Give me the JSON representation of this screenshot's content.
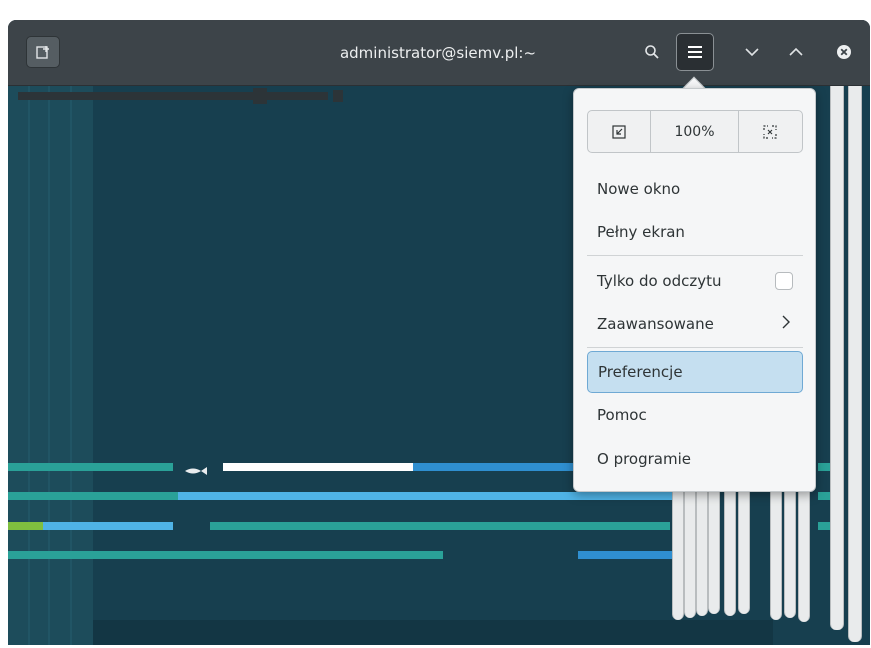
{
  "window": {
    "title": "administrator@siemv.pl:~"
  },
  "headerbar": {
    "new_tab_icon": "new-tab-icon",
    "search_icon": "search-icon",
    "menu_icon": "hamburger-icon",
    "find_next_icon": "chevron-down-icon",
    "find_prev_icon": "chevron-up-icon",
    "close_icon": "close-circle-icon"
  },
  "menu": {
    "zoom": {
      "zoom_out_icon": "zoom-out-icon",
      "level": "100%",
      "zoom_in_icon": "fullscreen-icon"
    },
    "items": [
      {
        "label": "Nowe okno"
      },
      {
        "label": "Pełny ekran"
      },
      {
        "label": "Tylko do odczytu",
        "checked": false
      },
      {
        "label": "Zaawansowane"
      },
      {
        "label": "Preferencje",
        "highlighted": true
      },
      {
        "label": "Pomoc"
      },
      {
        "label": "O programie"
      }
    ]
  },
  "colors": {
    "terminal_bg": "#173f4f",
    "headerbar_bg": "#3d4449",
    "accent_teal": "#2aa198",
    "accent_blue": "#3aa5e0",
    "highlight_bg": "#c5dff0"
  }
}
